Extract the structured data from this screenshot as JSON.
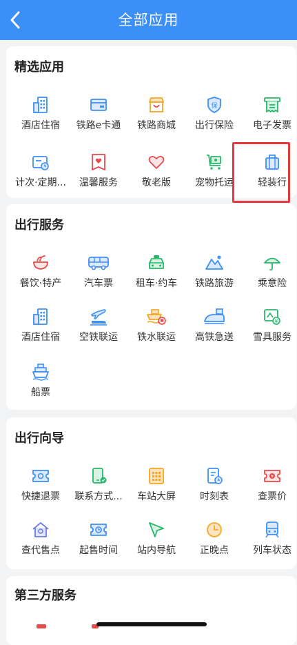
{
  "header": {
    "title": "全部应用"
  },
  "sections": {
    "featured": {
      "title": "精选应用",
      "apps": [
        {
          "label": "酒店住宿",
          "icon": "hotel-icon"
        },
        {
          "label": "铁路e卡通",
          "icon": "card-icon"
        },
        {
          "label": "铁路商城",
          "icon": "store-icon"
        },
        {
          "label": "出行保险",
          "icon": "insurance-icon"
        },
        {
          "label": "电子发票",
          "icon": "invoice-icon"
        },
        {
          "label": "计次·定期...",
          "icon": "ticket-calendar-icon"
        },
        {
          "label": "温馨服务",
          "icon": "heart-service-icon"
        },
        {
          "label": "敬老版",
          "icon": "heart-icon"
        },
        {
          "label": "宠物托运",
          "icon": "pet-cart-icon"
        },
        {
          "label": "轻装行",
          "icon": "luggage-icon"
        }
      ]
    },
    "travel_services": {
      "title": "出行服务",
      "apps": [
        {
          "label": "餐饮·特产",
          "icon": "food-bowl-icon"
        },
        {
          "label": "汽车票",
          "icon": "bus-icon"
        },
        {
          "label": "租车·约车",
          "icon": "taxi-icon"
        },
        {
          "label": "铁路旅游",
          "icon": "mountain-icon"
        },
        {
          "label": "乘意险",
          "icon": "umbrella-icon"
        },
        {
          "label": "酒店住宿",
          "icon": "hotel-icon"
        },
        {
          "label": "空铁联运",
          "icon": "plane-train-icon"
        },
        {
          "label": "铁水联运",
          "icon": "ship-train-icon"
        },
        {
          "label": "高铁急送",
          "icon": "express-train-icon"
        },
        {
          "label": "雪具服务",
          "icon": "ski-service-icon"
        },
        {
          "label": "船票",
          "icon": "ship-icon"
        }
      ]
    },
    "travel_guide": {
      "title": "出行向导",
      "apps": [
        {
          "label": "快捷退票",
          "icon": "refund-ticket-icon"
        },
        {
          "label": "联系方式...",
          "icon": "phone-contact-icon"
        },
        {
          "label": "车站大屏",
          "icon": "station-screen-icon"
        },
        {
          "label": "时刻表",
          "icon": "timetable-icon"
        },
        {
          "label": "查票价",
          "icon": "price-icon"
        },
        {
          "label": "查代售点",
          "icon": "agency-home-icon"
        },
        {
          "label": "起售时间",
          "icon": "sale-time-icon"
        },
        {
          "label": "站内导航",
          "icon": "navigation-arrow-icon"
        },
        {
          "label": "正晚点",
          "icon": "clock-icon"
        },
        {
          "label": "列车状态",
          "icon": "train-status-icon"
        }
      ]
    },
    "third_party": {
      "title": "第三方服务"
    }
  },
  "colors": {
    "header_bg": "#3b8ff6",
    "icon_blue": "#3b8ff6",
    "icon_orange": "#f5a623",
    "icon_red": "#e84a4a",
    "icon_green": "#27b66b",
    "highlight_border": "#e4393c"
  }
}
